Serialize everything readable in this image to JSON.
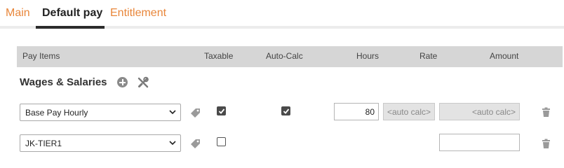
{
  "tabs": [
    {
      "label": "Main",
      "active": false
    },
    {
      "label": "Default pay",
      "active": true
    },
    {
      "label": "Entitlement",
      "active": false
    }
  ],
  "table": {
    "headers": [
      "Pay Items",
      "Taxable",
      "Auto-Calc",
      "Hours",
      "Rate",
      "Amount"
    ]
  },
  "section": {
    "title": "Wages & Salaries",
    "icons": [
      "add-circle-icon",
      "tools-icon"
    ]
  },
  "rows": [
    {
      "pay_item": "Base Pay Hourly",
      "taxable": true,
      "auto_calc": true,
      "hours": "80",
      "rate": "<auto calc>",
      "amount": "<auto calc>"
    },
    {
      "pay_item": "JK-TIER1",
      "taxable": false,
      "amount": ""
    }
  ],
  "colors": {
    "accent": "#e8863a",
    "header_bg": "#d6d6d6",
    "active_tab": "#222222",
    "icon_gray": "#8a8a8a"
  }
}
